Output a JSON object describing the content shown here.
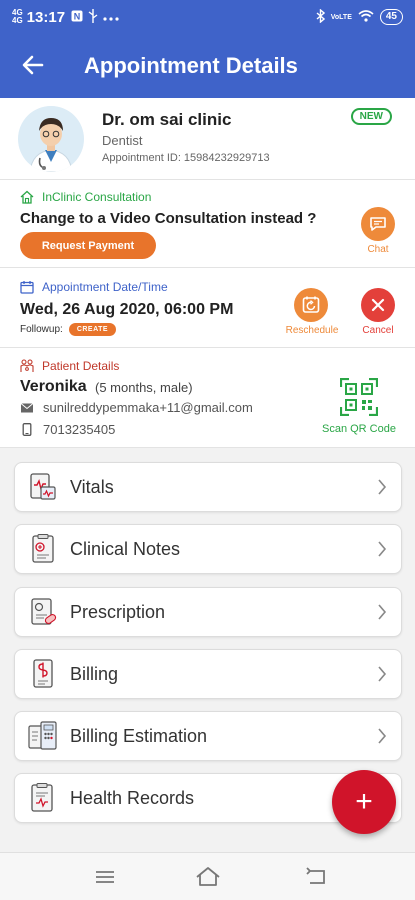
{
  "status_bar": {
    "network_top": "4G",
    "network_bottom": "4G",
    "time": "13:17",
    "icons": [
      "n-badge-icon",
      "usb-icon",
      "more-dots-icon"
    ],
    "right_icons": [
      "bluetooth-icon",
      "volte-icon",
      "wifi-icon"
    ],
    "volte": "VoLTE",
    "battery": "45"
  },
  "app_bar": {
    "title": "Appointment Details",
    "back_icon": "back-arrow-icon"
  },
  "doctor": {
    "name": "Dr. om sai clinic",
    "specialty": "Dentist",
    "appointment_id": "Appointment ID: 15984232929713",
    "badge": "NEW"
  },
  "consultation": {
    "heading": "InClinic Consultation",
    "question": "Change to a Video Consultation instead ?",
    "request_payment_label": "Request Payment",
    "chat_label": "Chat"
  },
  "schedule": {
    "heading": "Appointment Date/Time",
    "datetime": "Wed, 26 Aug 2020, 06:00 PM",
    "followup_label": "Followup:",
    "create_label": "CREATE",
    "reschedule_label": "Reschedule",
    "cancel_label": "Cancel"
  },
  "patient": {
    "heading": "Patient Details",
    "name": "Veronika",
    "meta": "(5 months, male)",
    "email": "sunilreddypemmaka+11@gmail.com",
    "phone": "7013235405",
    "scan_label": "Scan QR Code"
  },
  "menu": {
    "items": [
      {
        "label": "Vitals",
        "icon": "vitals-icon"
      },
      {
        "label": "Clinical Notes",
        "icon": "clinical-notes-icon"
      },
      {
        "label": "Prescription",
        "icon": "prescription-icon"
      },
      {
        "label": "Billing",
        "icon": "billing-icon"
      },
      {
        "label": "Billing Estimation",
        "icon": "billing-estimation-icon"
      },
      {
        "label": "Health Records",
        "icon": "health-records-icon"
      }
    ]
  },
  "fab": {
    "label": "+"
  },
  "colors": {
    "primary": "#3f63c9",
    "accent_orange": "#e8742b",
    "green": "#2aa646",
    "red": "#e3403a",
    "fab_red": "#d0142a"
  }
}
